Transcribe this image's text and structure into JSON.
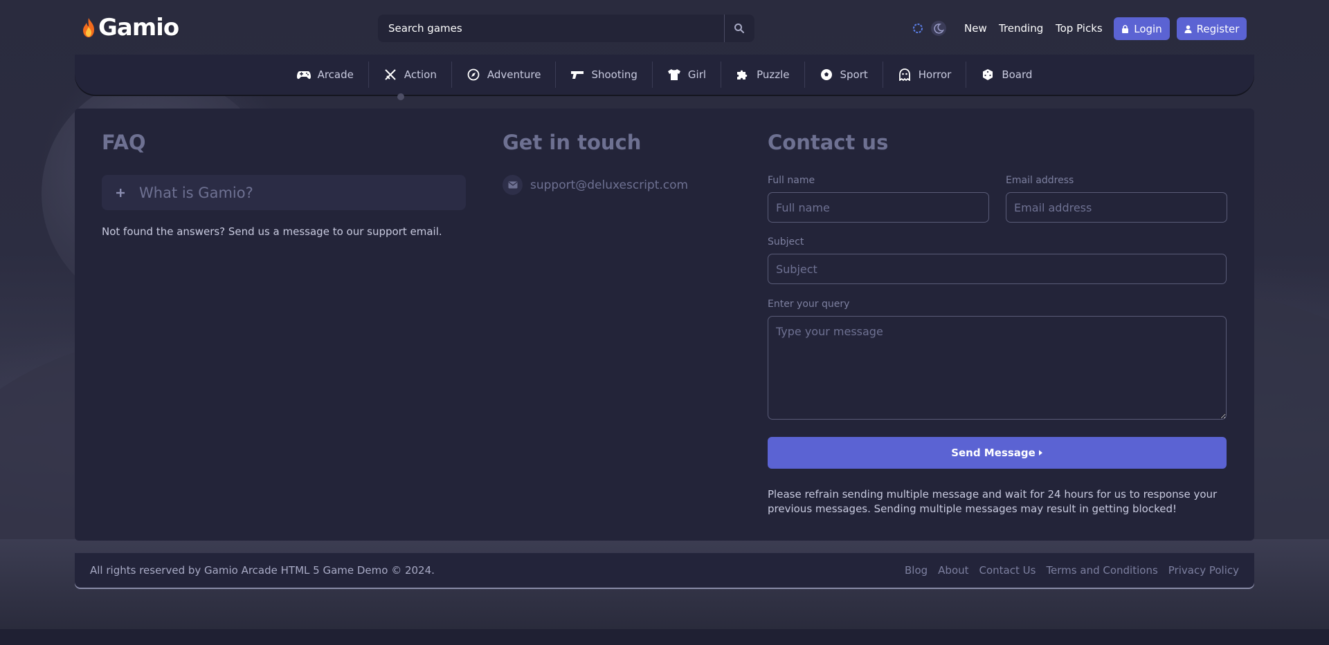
{
  "brand": {
    "name": "Gamio"
  },
  "search": {
    "placeholder": "Search games"
  },
  "header": {
    "nav": [
      "New",
      "Trending",
      "Top Picks"
    ],
    "login_label": "Login",
    "register_label": "Register"
  },
  "categories": [
    {
      "label": "Arcade",
      "icon": "gamepad-icon"
    },
    {
      "label": "Action",
      "icon": "swords-icon"
    },
    {
      "label": "Adventure",
      "icon": "compass-icon"
    },
    {
      "label": "Shooting",
      "icon": "gun-icon"
    },
    {
      "label": "Girl",
      "icon": "shirt-icon"
    },
    {
      "label": "Puzzle",
      "icon": "puzzle-icon"
    },
    {
      "label": "Sport",
      "icon": "soccer-ball-icon"
    },
    {
      "label": "Horror",
      "icon": "ghost-icon"
    },
    {
      "label": "Board",
      "icon": "dice-icon"
    }
  ],
  "faq": {
    "title": "FAQ",
    "items": [
      {
        "question": "What is Gamio?"
      }
    ],
    "note": "Not found the answers? Send us a message to our support email."
  },
  "touch": {
    "title": "Get in touch",
    "email": "support@deluxescript.com"
  },
  "contact": {
    "title": "Contact us",
    "fullname_label": "Full name",
    "fullname_placeholder": "Full name",
    "email_label": "Email address",
    "email_placeholder": "Email address",
    "subject_label": "Subject",
    "subject_placeholder": "Subject",
    "query_label": "Enter your query",
    "query_placeholder": "Type your message",
    "send_label": "Send Message",
    "warning": "Please refrain sending multiple message and wait for 24 hours for us to response your previous messages. Sending multiple messages may result in getting blocked!"
  },
  "footer": {
    "copyright": "All rights reserved by Gamio Arcade HTML 5 Game Demo © 2024.",
    "links": [
      "Blog",
      "About",
      "Contact Us",
      "Terms and Conditions",
      "Privacy Policy"
    ]
  },
  "colors": {
    "accent": "#5b63d3",
    "panel": "#23243a",
    "muted_heading": "#6e7192"
  }
}
